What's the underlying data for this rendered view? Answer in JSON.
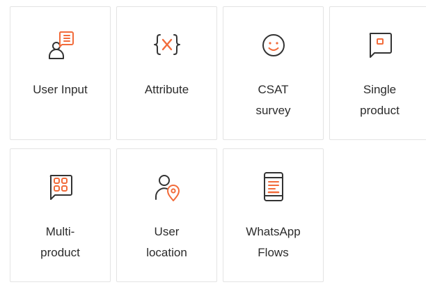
{
  "colors": {
    "icon_accent": "#f26b3a",
    "icon_dark": "#333333",
    "tile_border": "#e3e3e3",
    "text": "#2b2b2b"
  },
  "tiles": [
    {
      "icon": "user-input-icon",
      "label_lines": [
        "User Input"
      ]
    },
    {
      "icon": "attribute-variable-icon",
      "label_lines": [
        "Attribute"
      ]
    },
    {
      "icon": "smiley-icon",
      "label_lines": [
        "CSAT",
        "survey"
      ]
    },
    {
      "icon": "single-product-icon",
      "label_lines": [
        "Single",
        "product"
      ]
    },
    {
      "icon": "multi-product-grid-icon",
      "label_lines": [
        "Multi-",
        "product"
      ]
    },
    {
      "icon": "user-location-icon",
      "label_lines": [
        "User",
        "location"
      ]
    },
    {
      "icon": "whatsapp-flows-phone-icon",
      "label_lines": [
        "WhatsApp",
        "Flows"
      ]
    }
  ]
}
